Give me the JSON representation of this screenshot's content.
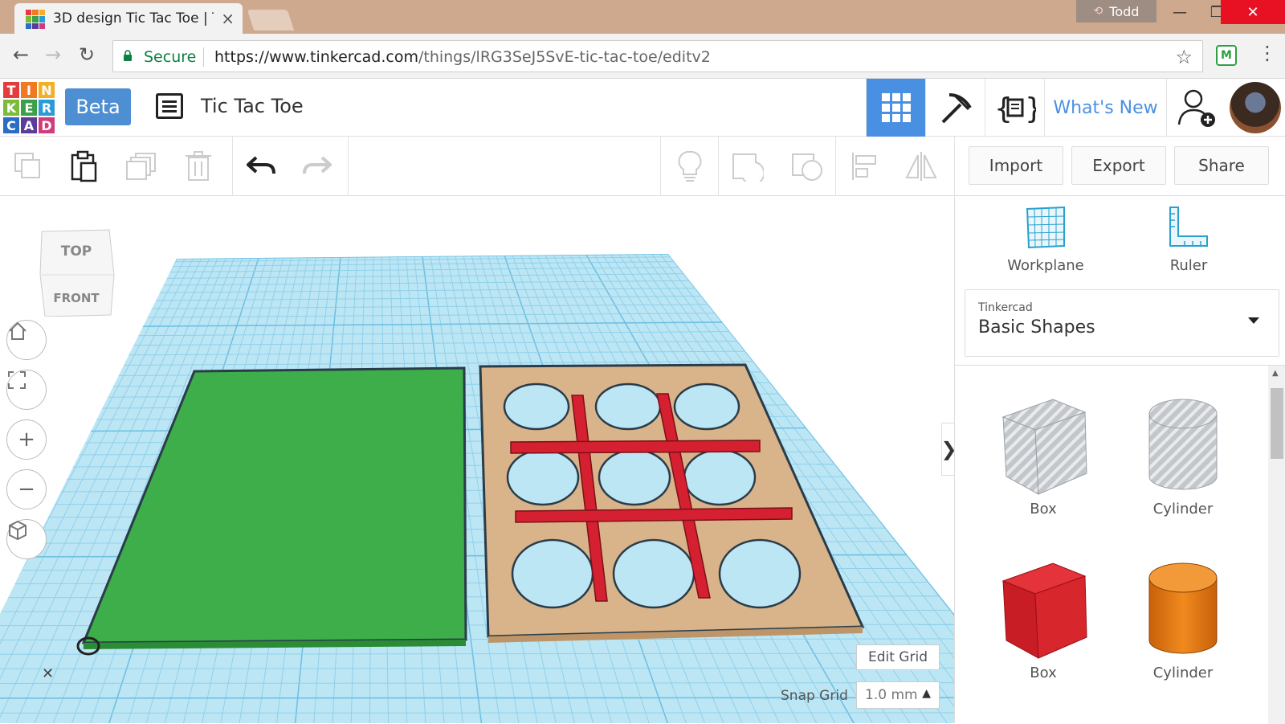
{
  "browser": {
    "tab_title": "3D design Tic Tac Toe | T",
    "user_name": "Todd",
    "secure_label": "Secure",
    "url_host": "https://www.tinkercad.com",
    "url_path": "/things/lRG3SeJ5SvE-tic-tac-toe/editv2",
    "extension_label": "M"
  },
  "header": {
    "logo_letters": [
      "T",
      "I",
      "N",
      "K",
      "E",
      "R",
      "C",
      "A",
      "D"
    ],
    "logo_colors": [
      "#e63b3b",
      "#f07a22",
      "#f2b022",
      "#7cbb3a",
      "#3aa04a",
      "#2a9bd7",
      "#2b6cc4",
      "#5a3d9a",
      "#d23a7a"
    ],
    "beta_label": "Beta",
    "design_title": "Tic Tac Toe",
    "whats_new": "What's New"
  },
  "toolbar": {
    "import_label": "Import",
    "export_label": "Export",
    "share_label": "Share"
  },
  "canvas": {
    "viewcube_top": "TOP",
    "viewcube_front": "FRONT",
    "edit_grid_label": "Edit Grid",
    "snap_grid_label": "Snap Grid",
    "snap_grid_value": "1.0 mm",
    "collapse_glyph": "❯",
    "colors": {
      "grid": "#a8dcf0",
      "green_plate": "#3dae49",
      "board": "#d9b48a",
      "bars": "#d42030"
    }
  },
  "panel": {
    "workplane_label": "Workplane",
    "ruler_label": "Ruler",
    "library_source": "Tinkercad",
    "library_name": "Basic Shapes",
    "shapes": [
      {
        "label": "Box",
        "icon": "box-hole-icon"
      },
      {
        "label": "Cylinder",
        "icon": "cylinder-hole-icon"
      },
      {
        "label": "Box",
        "icon": "box-red-icon"
      },
      {
        "label": "Cylinder",
        "icon": "cylinder-orange-icon"
      }
    ]
  }
}
